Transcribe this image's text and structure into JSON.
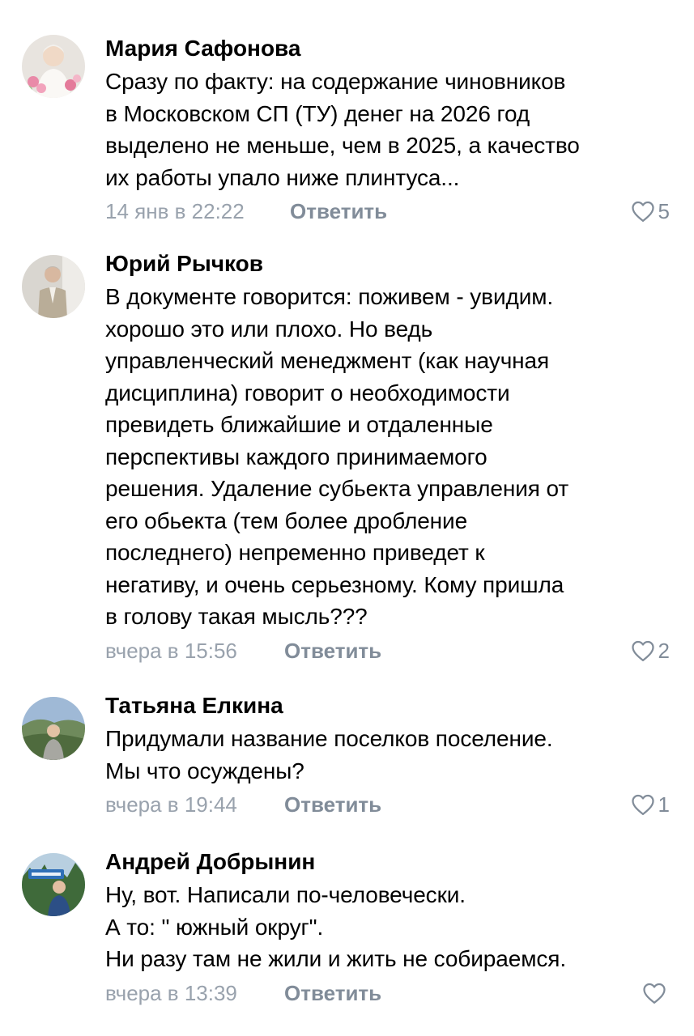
{
  "comments": [
    {
      "author": "Мария Сафонова",
      "text": "Сразу по факту: на содержание чиновников\nв Московском СП (ТУ) денег на 2026 год\nвыделено не меньше, чем в 2025, а качество\nих работы упало ниже плинтуса...",
      "time": "14 янв в 22:22",
      "reply_label": "Ответить",
      "likes": "5"
    },
    {
      "author": "Юрий Рычков",
      "text": "В документе говорится: поживем - увидим.\nхорошо это или плохо. Но ведь\nуправленческий менеджмент (как научная\nдисциплина) говорит о необходимости\nпревидеть ближайшие и отдаленные\nперспективы каждого принимаемого\nрешения. Удаление субьекта управления от\nего обьекта (тем более дробление\nпоследнего) непременно приведет к\nнегативу, и очень серьезному. Кому пришла\nв голову такая мысль???",
      "time": "вчера в 15:56",
      "reply_label": "Ответить",
      "likes": "2"
    },
    {
      "author": "Татьяна Елкина",
      "text": "Придумали название поселков поселение.\nМы что осуждены?",
      "time": "вчера в 19:44",
      "reply_label": "Ответить",
      "likes": "1"
    },
    {
      "author": "Андрей Добрынин",
      "text": "Ну, вот. Написали по-человечески.\nА то: \" южный округ\".\nНи разу там не жили и жить не собираемся.",
      "time": "вчера в 13:39",
      "reply_label": "Ответить",
      "likes": ""
    }
  ],
  "colors": {
    "text": "#000000",
    "secondary": "#818c99",
    "timestamp": "#99a2ad"
  },
  "icons": {
    "like": "heart-outline-icon"
  }
}
